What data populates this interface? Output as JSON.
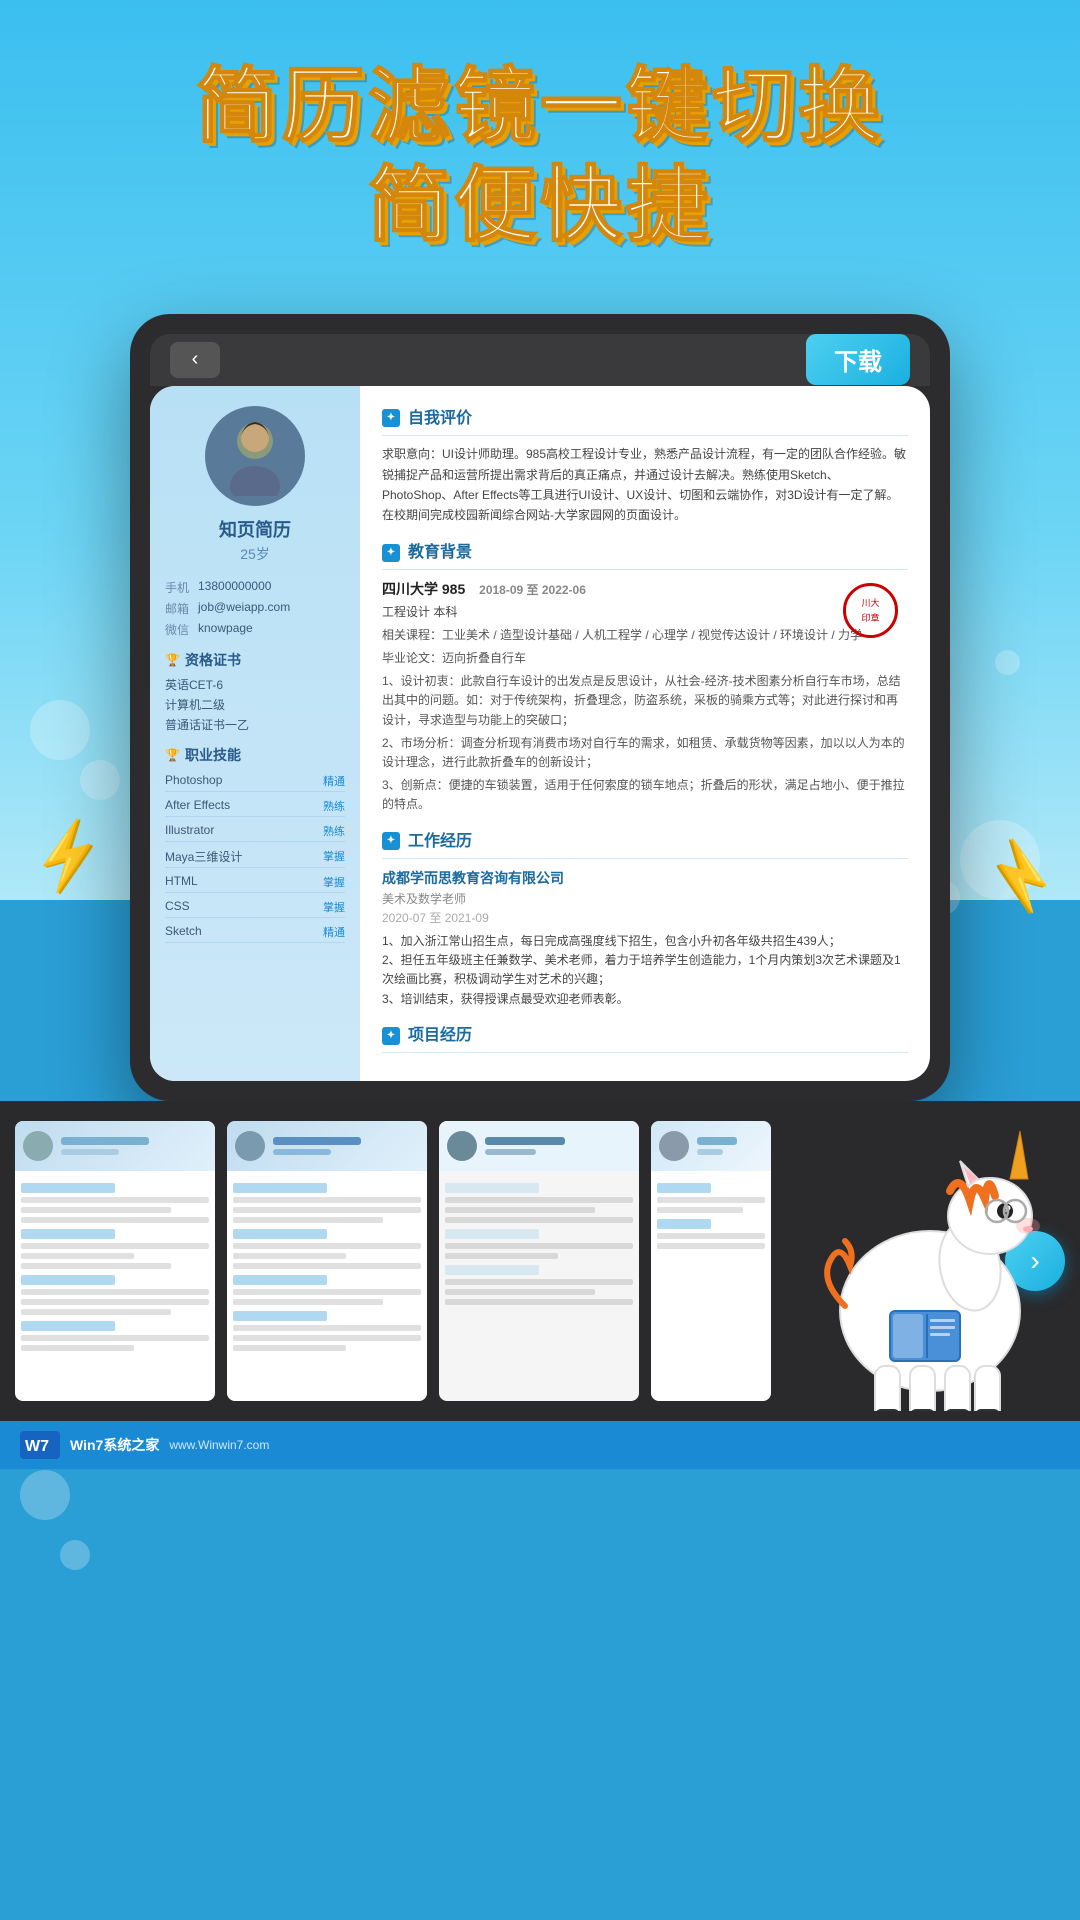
{
  "header": {
    "title_line1": "简历滤镜一键切换",
    "title_line2": "简便快捷"
  },
  "device": {
    "back_label": "‹",
    "download_label": "下载"
  },
  "resume": {
    "name": "知页简历",
    "age": "25岁",
    "contact": {
      "phone_label": "手机",
      "phone": "13800000000",
      "email_label": "邮箱",
      "email": "job@weiapp.com",
      "wechat_label": "微信",
      "wechat": "knowpage"
    },
    "cert_title": "资格证书",
    "certs": [
      "英语CET-6",
      "计算机二级",
      "普通话证书一乙"
    ],
    "skills_title": "职业技能",
    "skills": [
      {
        "name": "Photoshop",
        "level": "精通"
      },
      {
        "name": "After Effects",
        "level": "熟练"
      },
      {
        "name": "Illustrator",
        "level": "熟练"
      },
      {
        "name": "Maya三维设计",
        "level": "掌握"
      },
      {
        "name": "HTML",
        "level": "掌握"
      },
      {
        "name": "CSS",
        "level": "掌握"
      },
      {
        "name": "Sketch",
        "level": "精通"
      }
    ],
    "self_eval_title": "自我评价",
    "self_eval": "求职意向：UI设计师助理。985高校工程设计专业，熟悉产品设计流程，有一定的团队合作经验。敏锐捕捉产品和运营所提出需求背后的真正痛点，并通过设计去解决。熟练使用Sketch、PhotoShop、After Effects等工具进行UI设计、UX设计、切图和云端协作，对3D设计有一定了解。在校期间完成校园新闻综合网站-大学家园网的页面设计。",
    "edu_title": "教育背景",
    "education": {
      "school": "四川大学 985",
      "date": "2018-09 至 2022-06",
      "degree": "工程设计 本科",
      "courses": "相关课程：工业美术 / 造型设计基础 / 人机工程学 / 心理学 / 视觉传达设计 / 环境设计 / 力学",
      "thesis": "毕业论文：迈向折叠自行车",
      "desc1": "1、设计初衷：此款自行车设计的出发点是反思设计，从社会-经济-技术图素分析自行车市场，总结出其中的问题。如：对于传统架构，折叠理念，防盗系统，采板的骑乘方式等；对此进行探讨和再设计，寻求造型与功能上的突破口；",
      "desc2": "2、市场分析：调查分析现有消费市场对自行车的需求，如租赁、承载货物等因素，加以以人为本的设计理念，进行此款折叠车的创新设计；",
      "desc3": "3、创新点：便捷的车锁装置，适用于任何索度的锁车地点；折叠后的形状，满足占地小、便于推拉的特点。"
    },
    "work_title": "工作经历",
    "work": {
      "company": "成都学而思教育咨询有限公司",
      "position": "美术及数学老师",
      "date": "2020-07 至 2021-09",
      "desc1": "1、加入浙江常山招生点，每日完成高强度线下招生，包含小升初各年级共招生439人；",
      "desc2": "2、担任五年级班主任兼数学、美术老师，着力于培养学生创造能力，1个月内策划3次艺术课题及1次绘画比赛，积极调动学生对艺术的兴趣；",
      "desc3": "3、培训结束，获得授课点最受欢迎老师表彰。"
    },
    "project_title": "项目经历"
  },
  "thumbnails": [
    {
      "id": 1,
      "has_blue_header": true
    },
    {
      "id": 2,
      "has_blue_header": true
    },
    {
      "id": 3,
      "has_blue_header": false
    },
    {
      "id": 4,
      "has_blue_header": true
    }
  ],
  "navigation": {
    "next_label": "›"
  },
  "watermark": {
    "logo": "Win7系统之家",
    "url": "www.Winwin7.com"
  }
}
